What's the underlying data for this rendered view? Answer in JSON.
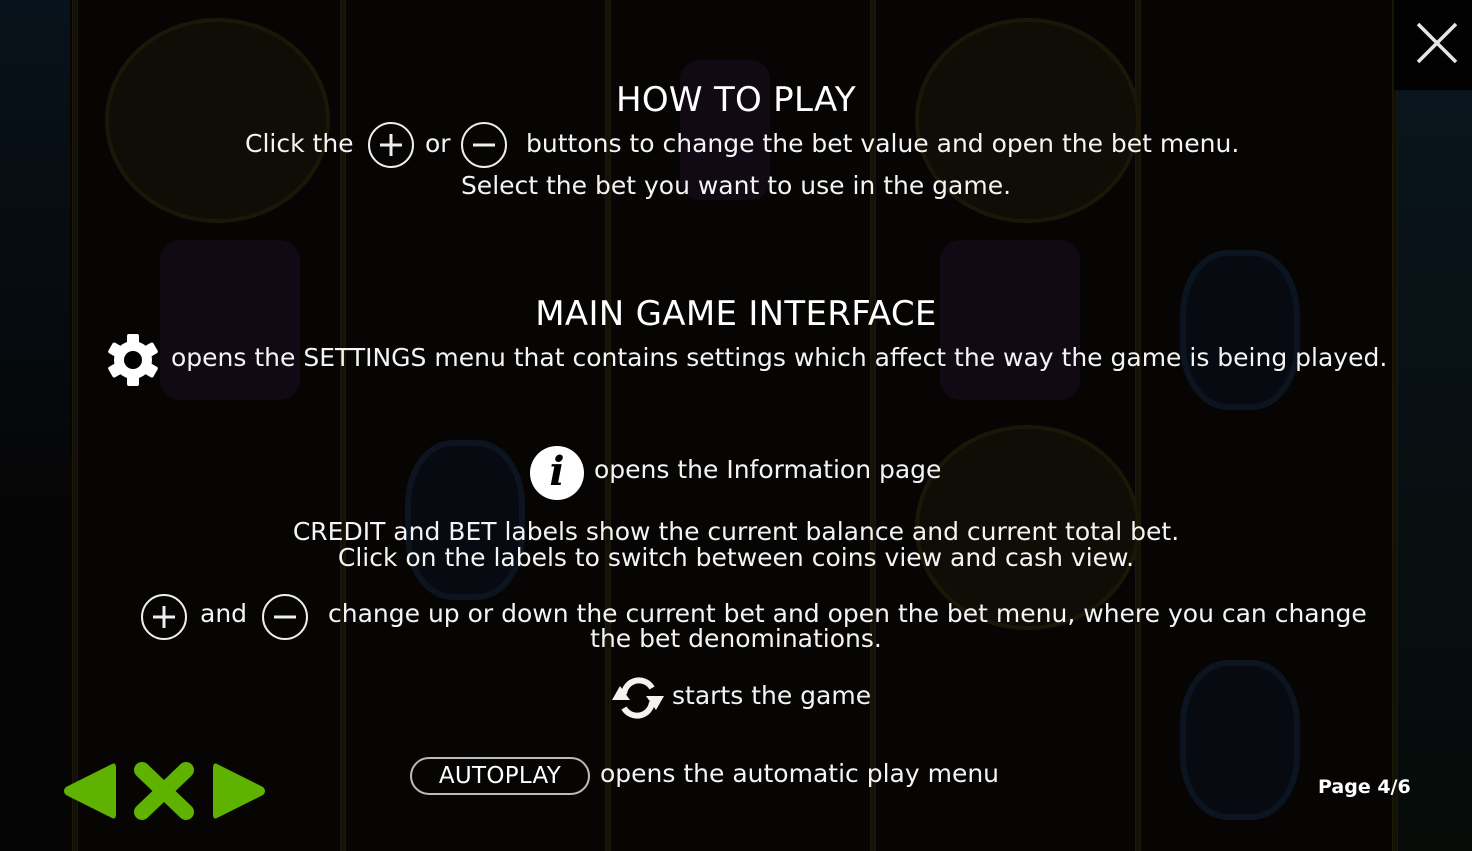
{
  "colors": {
    "nav_green": "#5fb300",
    "text": "#ffffff",
    "background": "#050505"
  },
  "how_to_play": {
    "title": "HOW TO PLAY",
    "line1_prefix": "Click the",
    "line1_or": "or",
    "line1_suffix": "buttons to change the bet value and open the bet menu.",
    "line2": "Select the bet you want to use in the game."
  },
  "main_interface": {
    "title": "MAIN GAME INTERFACE",
    "settings_text": "opens the SETTINGS menu that contains settings which affect the way the game is being played.",
    "info_text": "opens the Information page",
    "credit_line1": "CREDIT and BET labels show the current balance and current total bet.",
    "credit_line2": "Click on the labels to switch between coins view and cash view.",
    "bet_and": "and",
    "bet_line1": "change up or down the current bet and open the bet menu, where you can change",
    "bet_line2": "the bet denominations.",
    "spin_text": "starts the game",
    "autoplay_label": "AUTOPLAY",
    "autoplay_text": "opens the automatic play menu"
  },
  "icons": {
    "close": "close-icon",
    "plus": "plus-circle-icon",
    "minus": "minus-circle-icon",
    "settings": "gear-icon",
    "info": "info-icon",
    "spin": "spin-arrows-icon",
    "prev": "arrow-left-icon",
    "exit": "x-icon",
    "next": "arrow-right-icon"
  },
  "info_glyph": "i",
  "footer": {
    "page_label": "Page 4/6"
  }
}
